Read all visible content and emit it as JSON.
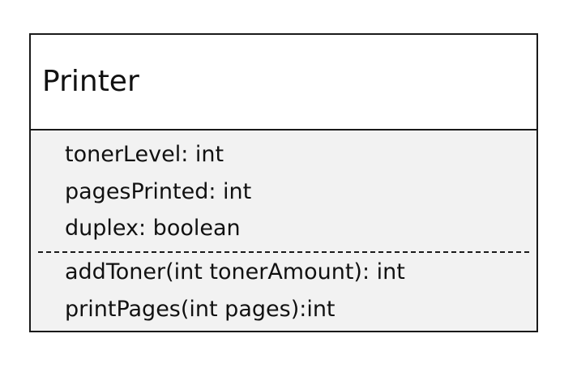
{
  "class": {
    "name": "Printer",
    "attributes": [
      "tonerLevel: int",
      "pagesPrinted: int",
      "duplex: boolean"
    ],
    "operations": [
      "addToner(int tonerAmount): int",
      "printPages(int pages):int"
    ]
  }
}
